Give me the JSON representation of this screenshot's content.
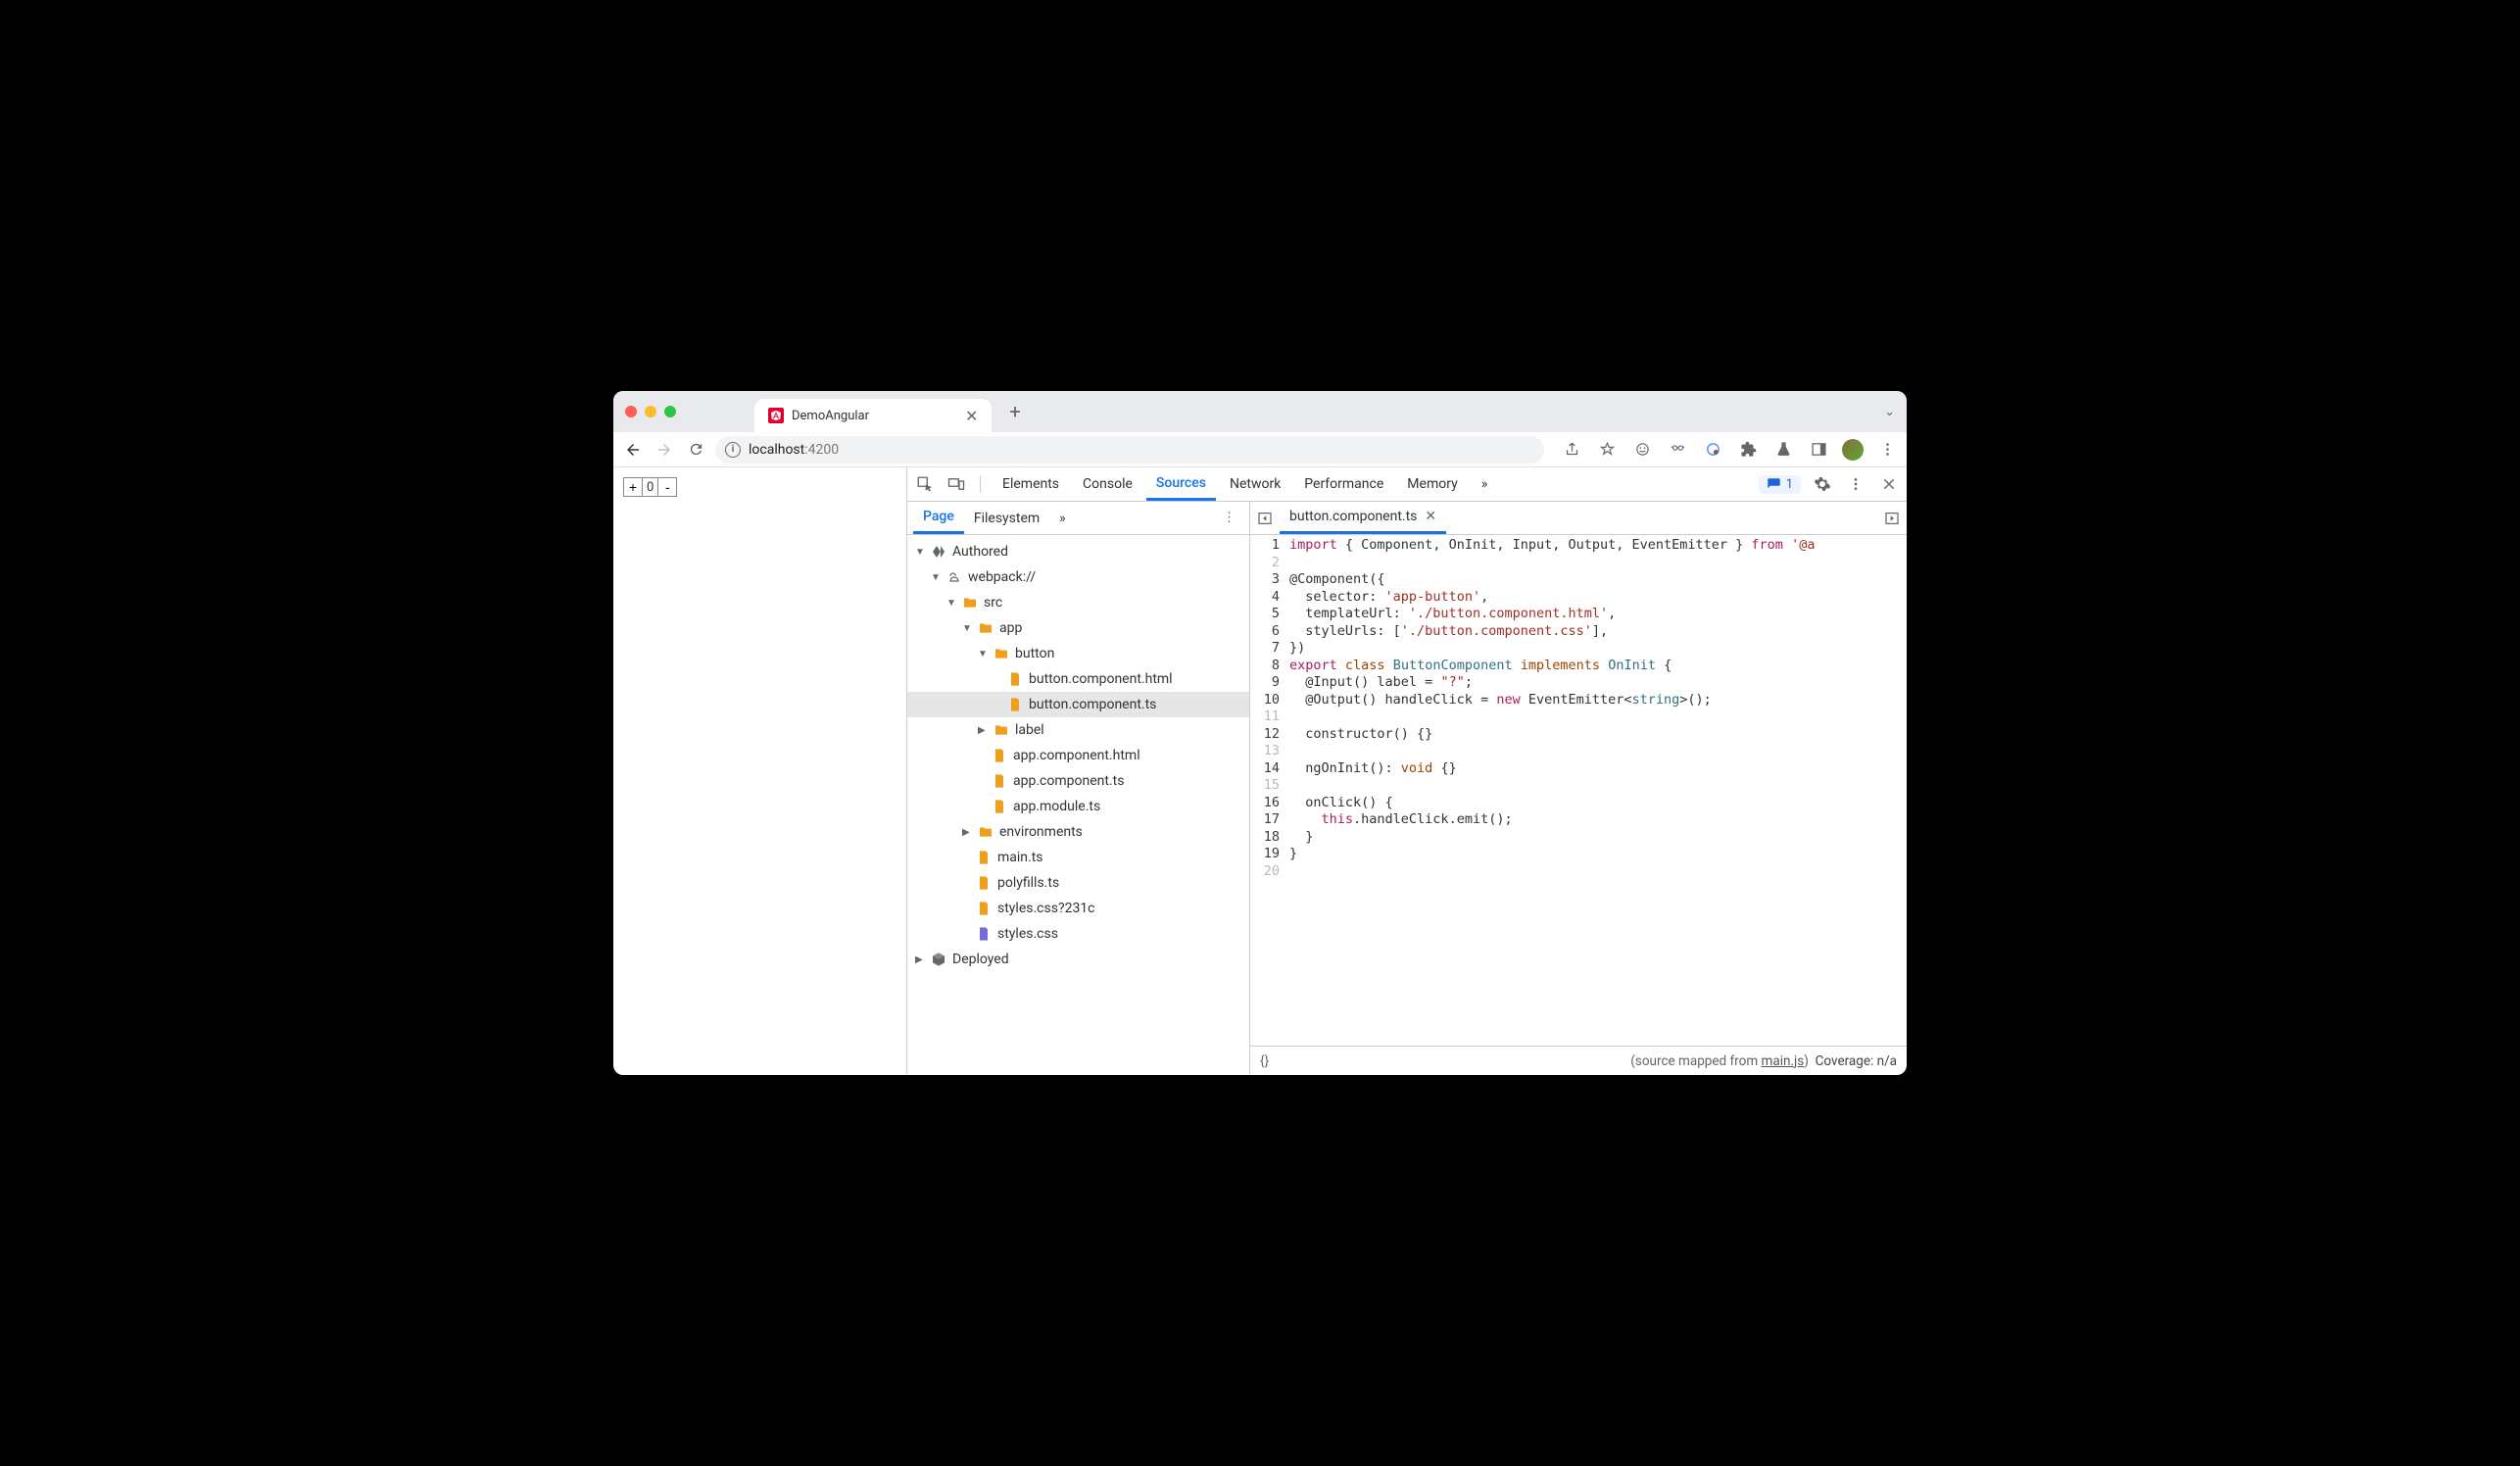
{
  "browser": {
    "tab_title": "DemoAngular",
    "url_host": "localhost",
    "url_port": ":4200"
  },
  "app": {
    "counter_minus": "-",
    "counter_val": "0",
    "counter_plus": "+"
  },
  "devtools": {
    "tabs": [
      "Elements",
      "Console",
      "Sources",
      "Network",
      "Performance",
      "Memory"
    ],
    "active_tab": "Sources",
    "issues_count": "1",
    "subtabs": {
      "page": "Page",
      "filesystem": "Filesystem"
    },
    "tree": {
      "authored": "Authored",
      "webpack": "webpack://",
      "src": "src",
      "app": "app",
      "button": "button",
      "button_html": "button.component.html",
      "button_ts": "button.component.ts",
      "label": "label",
      "app_component_html": "app.component.html",
      "app_component_ts": "app.component.ts",
      "app_module_ts": "app.module.ts",
      "environments": "environments",
      "main_ts": "main.ts",
      "polyfills_ts": "polyfills.ts",
      "styles_css_v": "styles.css?231c",
      "styles_css": "styles.css",
      "deployed": "Deployed"
    },
    "editor": {
      "open_file": "button.component.ts",
      "lines": [
        {
          "n": 1,
          "cls": "c",
          "html": "<span class='kw'>import</span> { Component, OnInit, Input, Output, EventEmitter } <span class='kw'>from</span> <span class='str'>'@a</span>"
        },
        {
          "n": 2,
          "cls": "",
          "html": ""
        },
        {
          "n": 3,
          "cls": "c",
          "html": "@Component({"
        },
        {
          "n": 4,
          "cls": "c",
          "html": "  selector: <span class='str'>'app-button'</span>,"
        },
        {
          "n": 5,
          "cls": "c",
          "html": "  templateUrl: <span class='str'>'./button.component.html'</span>,"
        },
        {
          "n": 6,
          "cls": "c",
          "html": "  styleUrls: [<span class='str'>'./button.component.css'</span>],"
        },
        {
          "n": 7,
          "cls": "c",
          "html": "})"
        },
        {
          "n": 8,
          "cls": "c",
          "html": "<span class='kw'>export</span> <span class='kw2'>class</span> <span class='cls'>ButtonComponent</span> <span class='kw2'>implements</span> <span class='cls'>OnInit</span> {"
        },
        {
          "n": 9,
          "cls": "c",
          "html": "  @Input() label = <span class='str'>\"?\"</span>;"
        },
        {
          "n": 10,
          "cls": "c",
          "html": "  @Output() handleClick = <span class='kw'>new</span> EventEmitter&lt;<span class='typ'>string</span>&gt;();"
        },
        {
          "n": 11,
          "cls": "",
          "html": ""
        },
        {
          "n": 12,
          "cls": "c",
          "html": "  constructor() {}"
        },
        {
          "n": 13,
          "cls": "",
          "html": ""
        },
        {
          "n": 14,
          "cls": "c",
          "html": "  ngOnInit(): <span class='kw2'>void</span> {}"
        },
        {
          "n": 15,
          "cls": "",
          "html": ""
        },
        {
          "n": 16,
          "cls": "c",
          "html": "  onClick() {"
        },
        {
          "n": 17,
          "cls": "c",
          "html": "    <span class='kw'>this</span>.handleClick.emit();"
        },
        {
          "n": 18,
          "cls": "c",
          "html": "  }"
        },
        {
          "n": 19,
          "cls": "c",
          "html": "}"
        },
        {
          "n": 20,
          "cls": "",
          "html": ""
        }
      ]
    },
    "statusbar": {
      "braces": "{}",
      "mapped_prefix": "(source mapped from ",
      "mapped_file": "main.js",
      "mapped_suffix": ")",
      "coverage": "Coverage: n/a"
    }
  }
}
